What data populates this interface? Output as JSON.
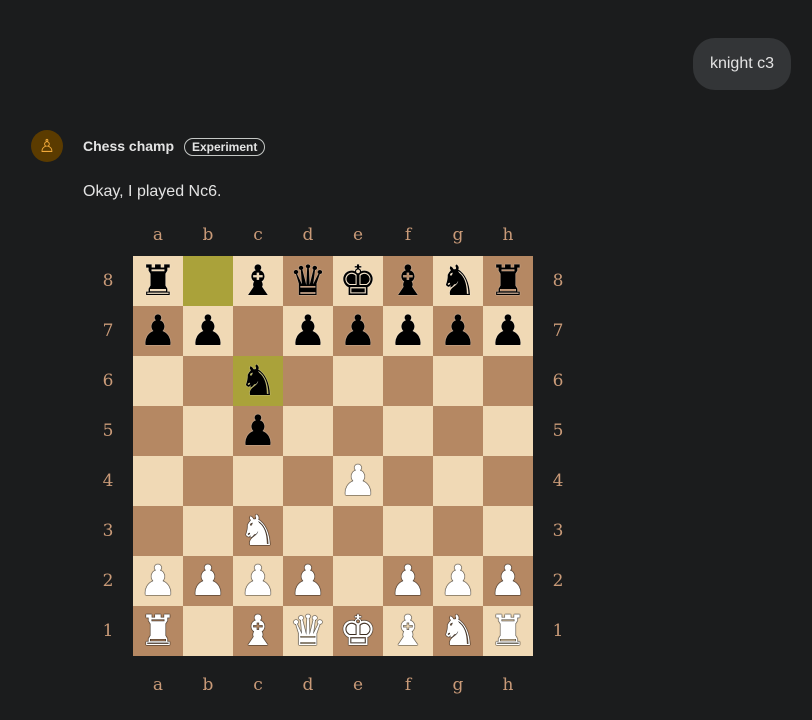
{
  "chat": {
    "user_message": "knight c3",
    "bot_name": "Chess champ",
    "badge": "Experiment",
    "reply": "Okay, I played Nc6."
  },
  "board": {
    "files": [
      "a",
      "b",
      "c",
      "d",
      "e",
      "f",
      "g",
      "h"
    ],
    "ranks": [
      "8",
      "7",
      "6",
      "5",
      "4",
      "3",
      "2",
      "1"
    ],
    "light_color": "#f0d9b5",
    "dark_color": "#b58863",
    "highlight_color": "#aaa23a",
    "highlighted_squares": [
      "b8",
      "c6"
    ],
    "fen": "r1bqkbnr/pp1ppppp/2n5/2p5/4P3/2N5/PPPP1PPP/R1BQKBNR"
  }
}
